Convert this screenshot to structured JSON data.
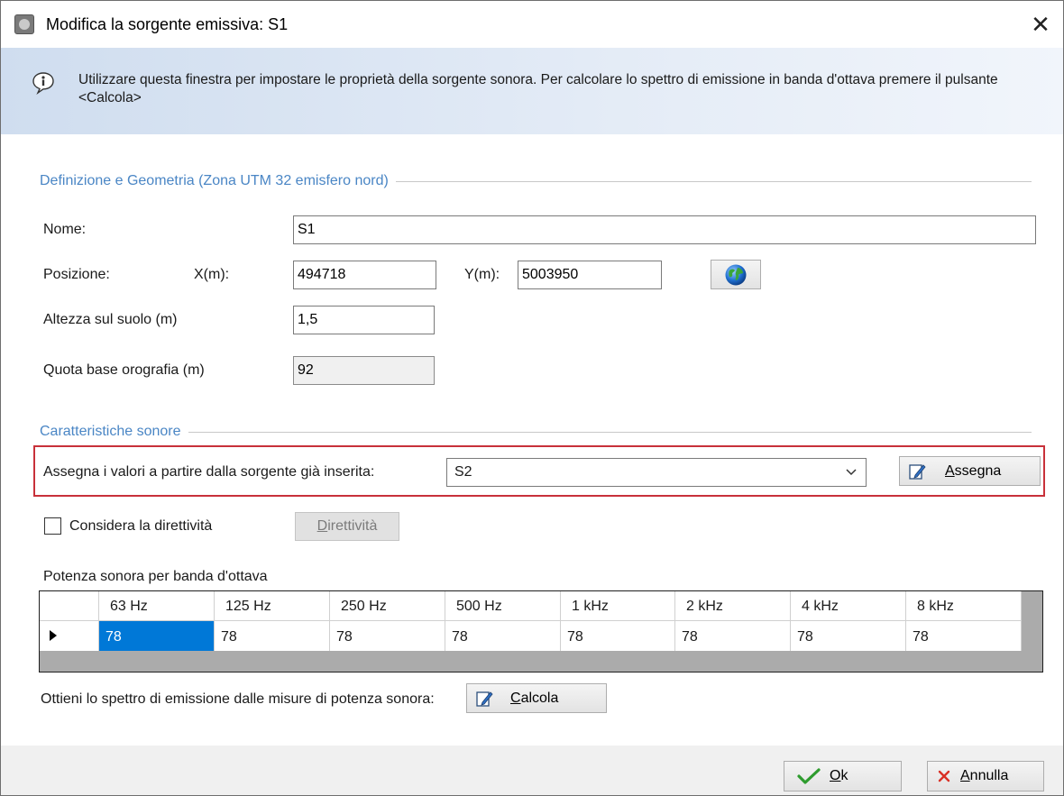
{
  "window": {
    "title": "Modifica la sorgente emissiva: S1",
    "close_glyph": "✕"
  },
  "info": {
    "icon": "info-speech-bubble-icon",
    "text": "Utilizzare questa finestra per impostare le proprietà della sorgente sonora. Per calcolare lo spettro di emissione in banda d'ottava premere il pulsante <Calcola>"
  },
  "geometry": {
    "section_title": "Definizione e Geometria (Zona UTM 32 emisfero nord)",
    "nome_label": "Nome:",
    "nome_value": "S1",
    "posizione_label": "Posizione:",
    "x_label": "X(m):",
    "x_value": "494718",
    "y_label": "Y(m):",
    "y_value": "5003950",
    "globe_icon": "globe-icon",
    "altezza_label": "Altezza sul suolo (m)",
    "altezza_value": "1,5",
    "quota_label": "Quota base orografia (m)",
    "quota_value": "92"
  },
  "sound": {
    "section_title": "Caratteristiche sonore",
    "assign_label": "Assegna i valori a partire dalla sorgente già inserita:",
    "assign_selected": "S2",
    "assign_button": {
      "first": "A",
      "rest": "ssegna"
    },
    "directivity_checkbox_label": "Considera la direttività",
    "directivity_checked": false,
    "directivity_button": {
      "first": "D",
      "rest": "irettività"
    },
    "power_label": "Potenza sonora per banda d'ottava",
    "bands": [
      "63 Hz",
      "125 Hz",
      "250 Hz",
      "500 Hz",
      "1 kHz",
      "2 kHz",
      "4 kHz",
      "8 kHz"
    ],
    "values": [
      "78",
      "78",
      "78",
      "78",
      "78",
      "78",
      "78",
      "78"
    ],
    "spectrum_label": "Ottieni lo spettro di emissione dalle misure di potenza sonora:",
    "calc_button": {
      "first": "C",
      "rest": "alcola"
    }
  },
  "footer": {
    "ok_button": {
      "first": "O",
      "rest": "k"
    },
    "cancel_button": {
      "first": "A",
      "rest": "nnulla"
    }
  },
  "colors": {
    "section_title": "#4a86c5",
    "highlight_border": "#c8313a",
    "selected_cell": "#0078d7",
    "ok_check": "#2e9c2e",
    "cancel_x": "#d93025"
  }
}
